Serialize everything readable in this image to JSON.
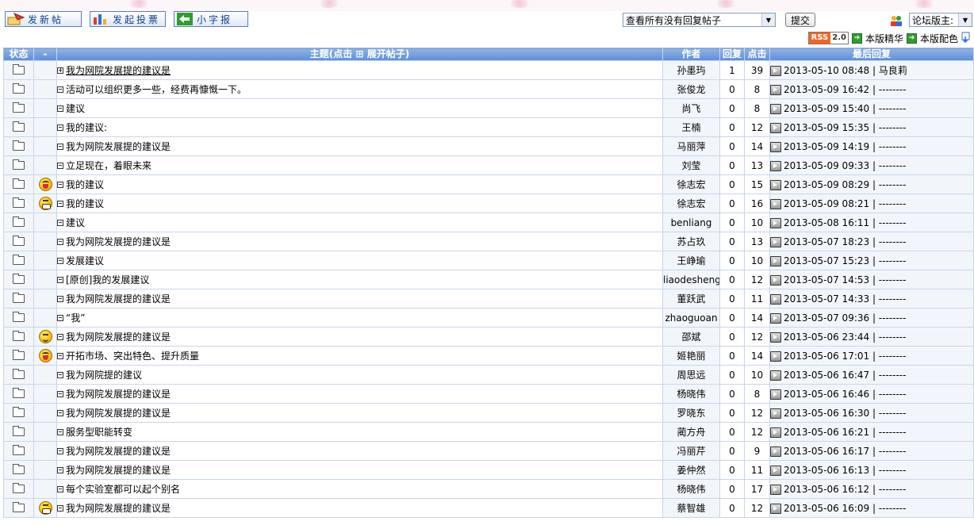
{
  "toolbar": {
    "new_post": "发新帖",
    "new_poll": "发起投票",
    "small_paper": "小字报",
    "filter_selected": "查看所有没有回复帖子",
    "submit": "提交",
    "role_selected": "论坛版主: ",
    "rss_label": "RSS",
    "rss_version": "2.0",
    "essence_link": "本版精华",
    "color_link": "本版配色"
  },
  "table": {
    "headers": {
      "status": "状态",
      "face": "-",
      "topic": "主题(点击 ⊞ 展开帖子)",
      "author": "作者",
      "replies": "回复",
      "hits": "点击",
      "last": "最后回复"
    },
    "rows": [
      {
        "face": "",
        "expand": "plus",
        "title": "我为网院发展提的建议是",
        "linked": true,
        "author": "孙墨玙",
        "replies": "1",
        "hits": "39",
        "last": "2013-05-10 08:48 | 马良莉"
      },
      {
        "face": "",
        "expand": "minus",
        "title": "活动可以组织更多一些，经费再慷慨一下。",
        "author": "张俊龙",
        "replies": "0",
        "hits": "8",
        "last": "2013-05-09 16:42 | --------"
      },
      {
        "face": "",
        "expand": "minus",
        "title": "建议",
        "author": "尚飞",
        "replies": "0",
        "hits": "8",
        "last": "2013-05-09 15:40 | --------"
      },
      {
        "face": "",
        "expand": "minus",
        "title": "我的建议:",
        "author": "王楠",
        "replies": "0",
        "hits": "12",
        "last": "2013-05-09 15:35 | --------"
      },
      {
        "face": "",
        "expand": "minus",
        "title": "我为网院发展提的建议是",
        "author": "马丽萍",
        "replies": "0",
        "hits": "14",
        "last": "2013-05-09 14:19 | --------"
      },
      {
        "face": "",
        "expand": "minus",
        "title": "立足现在，着眼未来",
        "author": "刘莹",
        "replies": "0",
        "hits": "13",
        "last": "2013-05-09 09:33 | --------"
      },
      {
        "face": "laugh",
        "expand": "minus",
        "title": "我的建议",
        "author": "徐志宏",
        "replies": "0",
        "hits": "15",
        "last": "2013-05-09 08:29 | --------"
      },
      {
        "face": "grin",
        "expand": "minus",
        "title": "我的建议",
        "author": "徐志宏",
        "replies": "0",
        "hits": "16",
        "last": "2013-05-09 08:21 | --------"
      },
      {
        "face": "",
        "expand": "minus",
        "title": "建议",
        "author": "benliang",
        "replies": "0",
        "hits": "10",
        "last": "2013-05-08 16:11 | --------"
      },
      {
        "face": "",
        "expand": "minus",
        "title": "我为网院发展提的建议是",
        "author": "苏占玖",
        "replies": "0",
        "hits": "13",
        "last": "2013-05-07 18:23 | --------"
      },
      {
        "face": "",
        "expand": "minus",
        "title": "发展建议",
        "author": "王峥瑜",
        "replies": "0",
        "hits": "10",
        "last": "2013-05-07 15:23 | --------"
      },
      {
        "face": "",
        "expand": "minus",
        "title": "[原创]我的发展建议",
        "author": "liaodesheng",
        "replies": "0",
        "hits": "12",
        "last": "2013-05-07 14:53 | --------"
      },
      {
        "face": "",
        "expand": "minus",
        "title": "我为网院发展提的建议是",
        "author": "董跃武",
        "replies": "0",
        "hits": "11",
        "last": "2013-05-07 14:33 | --------"
      },
      {
        "face": "",
        "expand": "minus",
        "title": "“我”",
        "author": "zhaoguoan",
        "replies": "0",
        "hits": "14",
        "last": "2013-05-07 09:36 | --------"
      },
      {
        "face": "wink",
        "expand": "minus",
        "title": "我为网院发展提的建议是",
        "author": "邵斌",
        "replies": "0",
        "hits": "12",
        "last": "2013-05-06 23:44 | --------"
      },
      {
        "face": "laugh",
        "expand": "minus",
        "title": "开拓市场、突出特色、提升质量",
        "author": "姬艳丽",
        "replies": "0",
        "hits": "14",
        "last": "2013-05-06 17:01 | --------"
      },
      {
        "face": "",
        "expand": "minus",
        "title": "我为网院提的建议",
        "author": "周思远",
        "replies": "0",
        "hits": "10",
        "last": "2013-05-06 16:47 | --------"
      },
      {
        "face": "",
        "expand": "minus",
        "title": "我为网院发展提的建议是",
        "author": "杨晓伟",
        "replies": "0",
        "hits": "8",
        "last": "2013-05-06 16:46 | --------"
      },
      {
        "face": "",
        "expand": "minus",
        "title": "我为网院发展提的建议是",
        "author": "罗晓东",
        "replies": "0",
        "hits": "12",
        "last": "2013-05-06 16:30 | --------"
      },
      {
        "face": "",
        "expand": "minus",
        "title": "服务型职能转变",
        "author": "蔺方舟",
        "replies": "0",
        "hits": "12",
        "last": "2013-05-06 16:21 | --------"
      },
      {
        "face": "",
        "expand": "minus",
        "title": "我为网院发展提的建议是",
        "author": "冯丽芹",
        "replies": "0",
        "hits": "9",
        "last": "2013-05-06 16:17 | --------"
      },
      {
        "face": "",
        "expand": "minus",
        "title": "我为网院发展提的建议是",
        "author": "姜仲然",
        "replies": "0",
        "hits": "11",
        "last": "2013-05-06 16:13 | --------"
      },
      {
        "face": "",
        "expand": "minus",
        "title": "每个实验室都可以起个别名",
        "author": "杨晓伟",
        "replies": "0",
        "hits": "17",
        "last": "2013-05-06 16:12 | --------"
      },
      {
        "face": "grin",
        "expand": "minus",
        "title": "我为网院发展提的建议是",
        "author": "蔡智雄",
        "replies": "0",
        "hits": "12",
        "last": "2013-05-06 16:09 | --------"
      }
    ]
  }
}
